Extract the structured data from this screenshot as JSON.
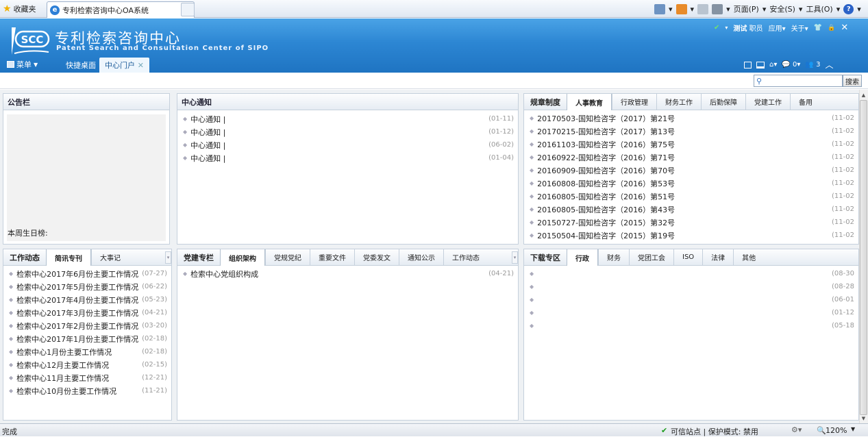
{
  "browser": {
    "favorites_label": "收藏夹",
    "tab_title": "专利检索咨询中心OA系统",
    "page_menu": "页面(P)",
    "safety_menu": "安全(S)",
    "tools_menu": "工具(O)",
    "help": "?"
  },
  "header": {
    "logo_text": "SCC",
    "title_cn": "专利检索咨询中心",
    "title_en": "Patent Search and Consultation Center of SIPO",
    "user_name": "测试",
    "user_role": "职员",
    "apps_label": "应用",
    "about_label": "关于",
    "menu_label": "菜单",
    "nav_tabs": [
      "快捷桌面",
      "中心门户"
    ],
    "msg_count": "0",
    "online_count": "3"
  },
  "search": {
    "button": "搜索"
  },
  "bulletin": {
    "title": "公告栏",
    "birthday_label": "本周生日榜:"
  },
  "notice": {
    "title": "中心通知",
    "items": [
      {
        "text": "中心通知 |",
        "date": "(01-11)"
      },
      {
        "text": "中心通知 |",
        "date": "(01-12)"
      },
      {
        "text": "中心通知 |",
        "date": "(06-02)"
      },
      {
        "text": "中心通知 |",
        "date": "(01-04)"
      }
    ]
  },
  "rules": {
    "label": "规章制度",
    "tabs": [
      "人事教育",
      "行政管理",
      "财务工作",
      "后勤保障",
      "党建工作",
      "备用"
    ],
    "items": [
      {
        "text": "20170503-国知检咨字（2017）第21号",
        "date": "(11-02"
      },
      {
        "text": "20170215-国知检咨字（2017）第13号",
        "date": "(11-02"
      },
      {
        "text": "20161103-国知检咨字（2016）第75号",
        "date": "(11-02"
      },
      {
        "text": "20160922-国知检咨字（2016）第71号",
        "date": "(11-02"
      },
      {
        "text": "20160909-国知检咨字（2016）第70号",
        "date": "(11-02"
      },
      {
        "text": "20160808-国知检咨字（2016）第53号",
        "date": "(11-02"
      },
      {
        "text": "20160805-国知检咨字（2016）第51号",
        "date": "(11-02"
      },
      {
        "text": "20160805-国知检咨字（2016）第43号",
        "date": "(11-02"
      },
      {
        "text": "20150727-国知检咨字（2015）第32号",
        "date": "(11-02"
      },
      {
        "text": "20150504-国知检咨字（2015）第19号",
        "date": "(11-02"
      }
    ]
  },
  "work": {
    "label": "工作动态",
    "tabs": [
      "简讯专刊",
      "大事记"
    ],
    "items": [
      {
        "text": "检索中心2017年6月份主要工作情况",
        "date": "(07-27)"
      },
      {
        "text": "检索中心2017年5月份主要工作情况",
        "date": "(06-22)"
      },
      {
        "text": "检索中心2017年4月份主要工作情况",
        "date": "(05-23)"
      },
      {
        "text": "检索中心2017年3月份主要工作情况",
        "date": "(04-21)"
      },
      {
        "text": "检索中心2017年2月份主要工作情况",
        "date": "(03-20)"
      },
      {
        "text": "检索中心2017年1月份主要工作情况",
        "date": "(02-18)"
      },
      {
        "text": "检索中心1月份主要工作情况",
        "date": "(02-18)"
      },
      {
        "text": "检索中心12月主要工作情况",
        "date": "(02-15)"
      },
      {
        "text": "检索中心11月主要工作情况",
        "date": "(12-21)"
      },
      {
        "text": "检索中心10月份主要工作情况",
        "date": "(11-21)"
      }
    ]
  },
  "party": {
    "label": "党建专栏",
    "tabs": [
      "组织架构",
      "党规党纪",
      "重要文件",
      "党委发文",
      "通知公示",
      "工作动态"
    ],
    "items": [
      {
        "text": "检索中心党组织构成",
        "date": "(04-21)"
      }
    ]
  },
  "download": {
    "label": "下载专区",
    "tabs": [
      "行政",
      "财务",
      "党团工会",
      "ISO",
      "法律",
      "其他"
    ],
    "items": [
      {
        "text": "",
        "date": "(08-30"
      },
      {
        "text": "",
        "date": "(08-28"
      },
      {
        "text": "",
        "date": "(06-01"
      },
      {
        "text": "",
        "date": "(01-12"
      },
      {
        "text": "",
        "date": "(05-18"
      }
    ]
  },
  "statusbar": {
    "left": "完成",
    "zone": "可信站点 | 保护模式: 禁用",
    "zoom": "120%"
  }
}
